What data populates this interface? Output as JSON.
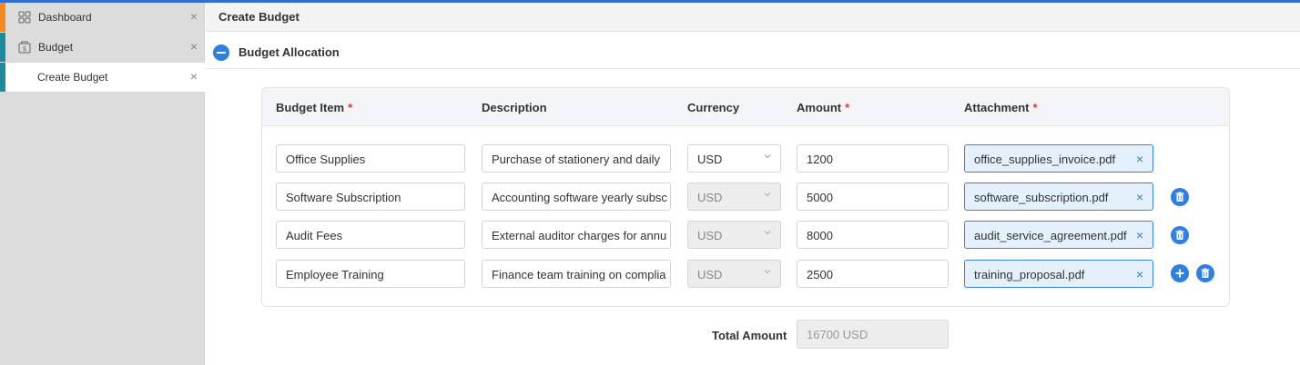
{
  "sidebar": {
    "items": [
      {
        "label": "Dashboard",
        "icon": "grid-icon",
        "accent": "#f08a24"
      },
      {
        "label": "Budget",
        "icon": "wallet-icon",
        "accent": "#1f8a9a"
      },
      {
        "label": "Create Budget",
        "accent": "#1f8a9a"
      }
    ],
    "close_glyph": "×"
  },
  "header": {
    "title": "Create Budget"
  },
  "section": {
    "title": "Budget Allocation"
  },
  "table": {
    "headers": {
      "item": "Budget Item",
      "description": "Description",
      "currency": "Currency",
      "amount": "Amount",
      "attachment": "Attachment",
      "required_mark": "*"
    },
    "rows": [
      {
        "item": "Office Supplies",
        "description": "Purchase of stationery and daily",
        "currency": "USD",
        "amount": "1200",
        "attachment": "office_supplies_invoice.pdf"
      },
      {
        "item": "Software Subscription",
        "description": "Accounting software yearly subsc",
        "currency": "USD",
        "amount": "5000",
        "attachment": "software_subscription.pdf"
      },
      {
        "item": "Audit Fees",
        "description": "External auditor charges for annu",
        "currency": "USD",
        "amount": "8000",
        "attachment": "audit_service_agreement.pdf"
      },
      {
        "item": "Employee Training",
        "description": "Finance team training on complia",
        "currency": "USD",
        "amount": "2500",
        "attachment": "training_proposal.pdf"
      }
    ],
    "remove_glyph": "×"
  },
  "total": {
    "label": "Total Amount",
    "value": "16700 USD"
  },
  "colors": {
    "accent": "#2f7fe0",
    "required": "#e53935"
  }
}
